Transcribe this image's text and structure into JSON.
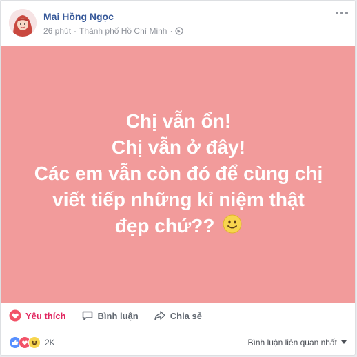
{
  "post": {
    "author": "Mai Hồng Ngọc",
    "time": "26 phút",
    "separator": "·",
    "location": "Thành phố Hồ Chí Minh",
    "lines": [
      "Chị vẫn ổn!",
      "Chị vẫn ở đây!",
      "Các em vẫn còn đó để cùng chị",
      "viết tiếp những kỉ niệm thật",
      "đẹp chứ??"
    ],
    "background_color": "#f29b9b"
  },
  "actions": {
    "like_label": "Yêu thích",
    "comment_label": "Bình luận",
    "share_label": "Chia sẻ"
  },
  "footer": {
    "reaction_icons": [
      "like-icon",
      "love-icon",
      "haha-icon"
    ],
    "reaction_count": "2K",
    "sort_label": "Bình luận liên quan nhất"
  },
  "colors": {
    "link_blue": "#365899",
    "love_red": "#e0245e",
    "like_blue": "#5890ff"
  }
}
